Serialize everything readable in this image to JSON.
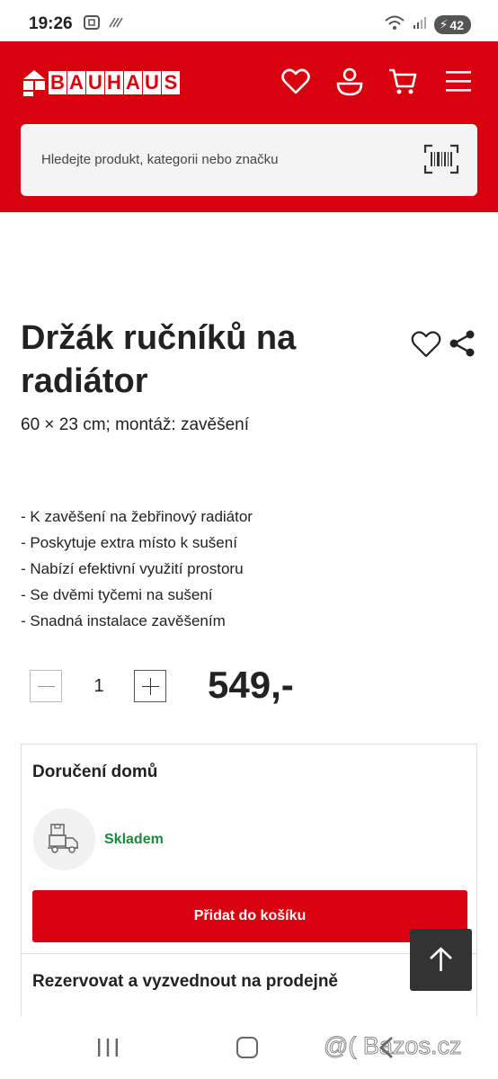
{
  "status_bar": {
    "time": "19:26",
    "battery": "42",
    "icons": [
      "screenshot-icon",
      "nfc-icon",
      "wifi-icon",
      "signal-icon",
      "battery-icon"
    ]
  },
  "header": {
    "logo_letters": [
      "B",
      "A",
      "U",
      "H",
      "A",
      "U",
      "S"
    ],
    "logo_alt": "BAUHAUS",
    "brand_color": "#d8000f",
    "icons": [
      "favorites-icon",
      "account-icon",
      "cart-icon",
      "menu-icon"
    ]
  },
  "search": {
    "placeholder": "Hledejte produkt, kategorii nebo značku",
    "icon": "barcode-scan-icon"
  },
  "product": {
    "title": "Držák ručníků na radiátor",
    "subtitle": "60 × 23 cm; montáž: zavěšení",
    "features": [
      "- K zavěšení na žebřinový radiátor",
      "- Poskytuje extra místo k sušení",
      "- Nabízí efektivní využití prostoru",
      "- Se dvěmi tyčemi na sušení",
      "- Snadná instalace zavěšením"
    ],
    "quantity": "1",
    "price": "549,-"
  },
  "delivery": {
    "title": "Doručení domů",
    "stock_status": "Skladem",
    "stock_color": "#1c8a3b",
    "add_to_cart": "Přidat do košíku",
    "reserve_title": "Rezervovat a vyzvednout na prodejně"
  },
  "watermark": "@( Bazos.cz"
}
